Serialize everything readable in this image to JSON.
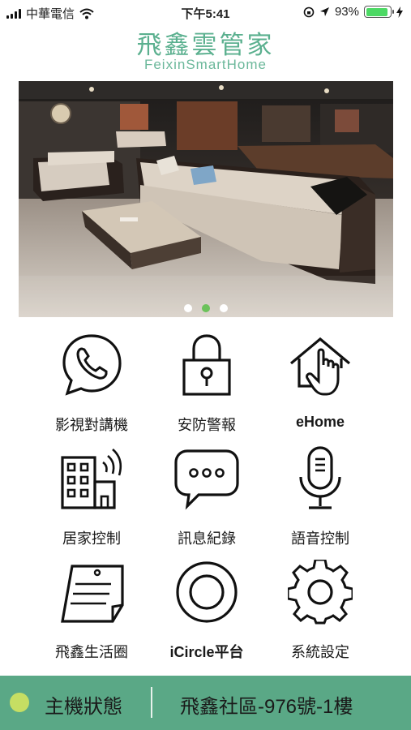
{
  "status_bar": {
    "carrier": "中華電信",
    "time": "下午5:41",
    "battery_percent": "93%",
    "battery_level": 0.93
  },
  "brand": {
    "title": "飛鑫雲管家",
    "subtitle": "FeixinSmartHome"
  },
  "banner": {
    "slide_count": 3,
    "active_slide": 2
  },
  "menu": [
    {
      "label": "影視對講機",
      "icon": "phone-icon"
    },
    {
      "label": "安防警報",
      "icon": "padlock-icon"
    },
    {
      "label": "eHome",
      "icon": "home-touch-icon"
    },
    {
      "label": "居家控制",
      "icon": "building-wifi-icon"
    },
    {
      "label": "訊息紀錄",
      "icon": "chat-bubble-icon"
    },
    {
      "label": "語音控制",
      "icon": "microphone-icon"
    },
    {
      "label": "飛鑫生活圈",
      "icon": "notepad-icon"
    },
    {
      "label": "iCircle平台",
      "icon": "ring-icon"
    },
    {
      "label": "系統設定",
      "icon": "gear-icon"
    }
  ],
  "bottom_bar": {
    "host_label": "主機狀態",
    "location": "飛鑫社區-976號-1樓"
  },
  "colors": {
    "brand_green": "#5bb08f",
    "bottom_bar": "#5aa886",
    "status_dot": "#c6de63",
    "active_dot": "#6bc25a"
  }
}
